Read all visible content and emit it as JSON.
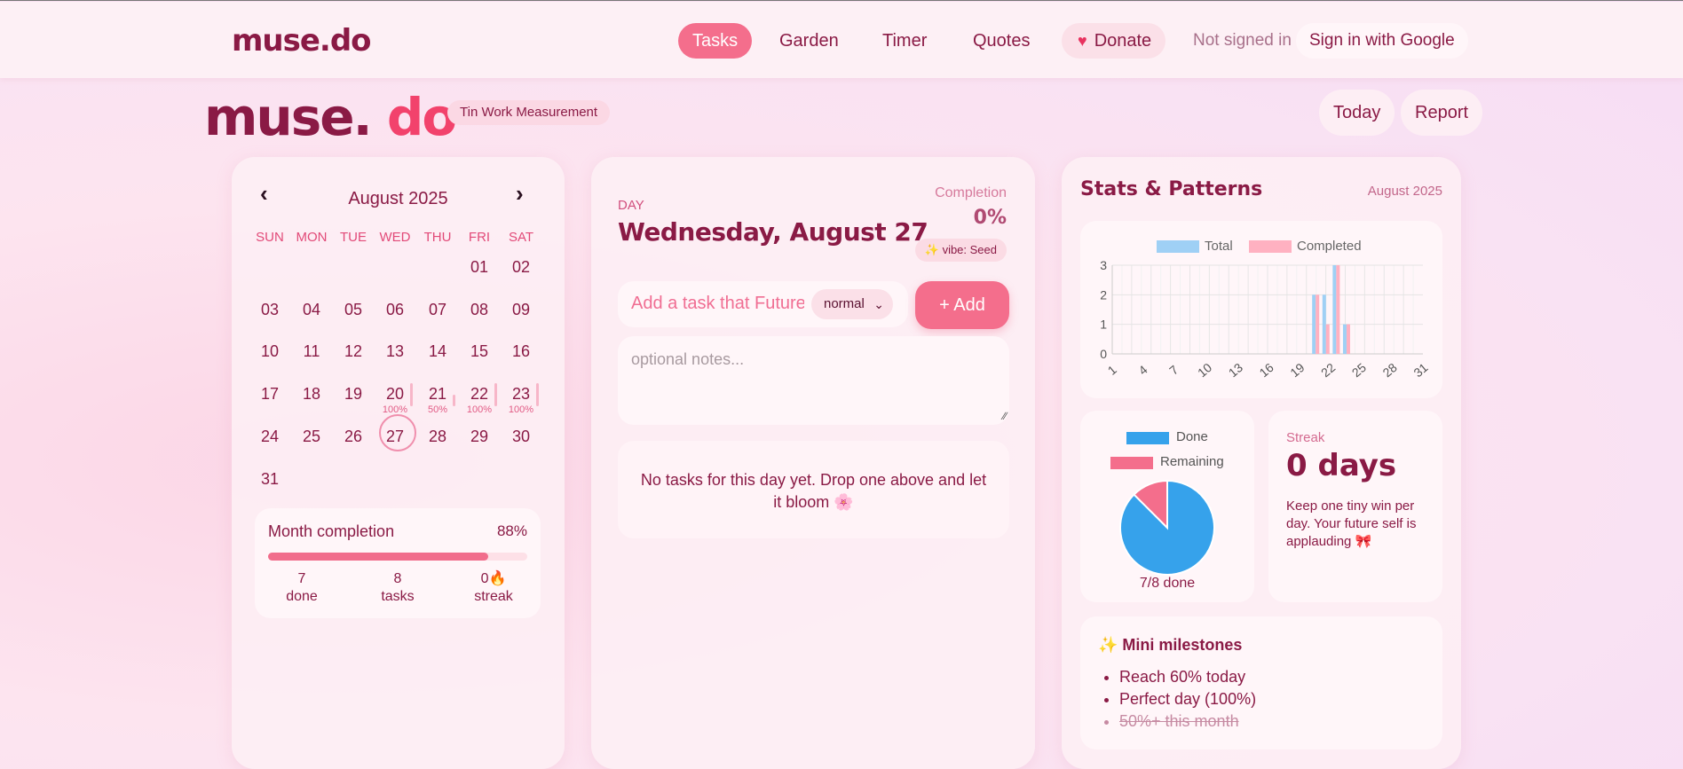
{
  "nav": {
    "brand": "muse.do",
    "items": [
      "Tasks",
      "Garden",
      "Timer",
      "Quotes"
    ],
    "donate": "Donate",
    "status": "Not signed in",
    "signin": "Sign in with Google"
  },
  "hero": {
    "logo_a": "muse.",
    "logo_b": "do",
    "badge": "Tin Work Measurement",
    "today": "Today",
    "report": "Report"
  },
  "calendar": {
    "title": "August 2025",
    "dow": [
      "SUN",
      "MON",
      "TUE",
      "WED",
      "THU",
      "FRI",
      "SAT"
    ],
    "first_weekday": 5,
    "days_in_month": 31,
    "today": 27,
    "progress": {
      "20": 100,
      "21": 50,
      "22": 100,
      "23": 100
    },
    "month_completion_label": "Month completion",
    "month_completion_value": "88%",
    "month_completion_fraction": 0.88,
    "done": "7",
    "done_label": "done",
    "tasks": "8",
    "tasks_label": "tasks",
    "streak": "0🔥",
    "streak_label": "streak"
  },
  "day": {
    "label": "DAY",
    "title": "Wednesday, August 27",
    "completion_label": "Completion",
    "completion_value": "0%",
    "vibe": "✨ vibe: Seed",
    "task_placeholder": "Add a task that Future",
    "priority": "normal",
    "add_button": "+ Add",
    "notes_placeholder": "optional notes...",
    "empty": "No tasks for this day yet. Drop one above and let it bloom 🌸"
  },
  "stats": {
    "title": "Stats & Patterns",
    "month": "August 2025",
    "streak_label": "Streak",
    "streak_value": "0 days",
    "streak_message": "Keep one tiny win per day. Your future self is applauding 🎀",
    "pie_caption": "7/8 done",
    "milestones_title": "✨ Mini milestones",
    "milestones": [
      {
        "text": "Reach 60% today",
        "done": false
      },
      {
        "text": "Perfect day (100%)",
        "done": false
      },
      {
        "text": "50%+ this month",
        "done": true
      }
    ]
  },
  "chart_data": [
    {
      "type": "bar",
      "series": [
        {
          "name": "Total",
          "color": "#9fd0f5",
          "values": {
            "20": 2,
            "21": 2,
            "22": 3,
            "23": 1
          }
        },
        {
          "name": "Completed",
          "color": "#ffb1c1",
          "values": {
            "20": 2,
            "21": 1,
            "22": 3,
            "23": 1
          }
        }
      ],
      "x_ticks": [
        "1",
        "4",
        "7",
        "10",
        "13",
        "16",
        "19",
        "22",
        "25",
        "28",
        "31"
      ],
      "x_range": [
        1,
        31
      ],
      "ylim": [
        0,
        3
      ],
      "y_ticks": [
        "0",
        "1",
        "2",
        "3"
      ],
      "grid": true,
      "legend": "top"
    },
    {
      "type": "pie",
      "slices": [
        {
          "name": "Done",
          "value": 7,
          "color": "#36a2eb"
        },
        {
          "name": "Remaining",
          "value": 1,
          "color": "#f46e8c"
        }
      ],
      "legend": "top"
    }
  ]
}
